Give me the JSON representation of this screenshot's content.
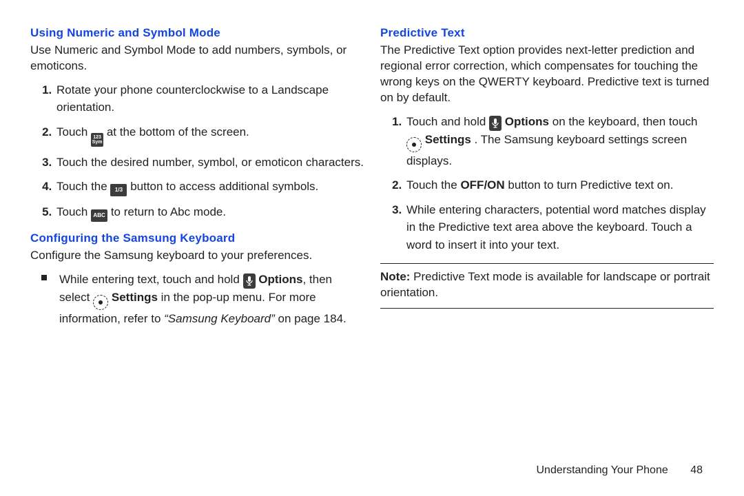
{
  "left": {
    "h_numeric": "Using Numeric and Symbol Mode",
    "numeric_intro": "Use Numeric and Symbol Mode to add numbers, symbols, or emoticons.",
    "steps_numsym": [
      {
        "a": "Rotate your phone counterclockwise to a Landscape orientation."
      },
      {
        "a": "Touch ",
        "icon": "123sym",
        "b": " at the bottom of the screen."
      },
      {
        "a": "Touch the desired number, symbol, or emoticon characters."
      },
      {
        "a": "Touch the ",
        "icon": "1of3",
        "b": " button to access additional symbols."
      },
      {
        "a": "Touch ",
        "icon": "abc",
        "b": " to return to Abc mode."
      }
    ],
    "h_config": "Configuring the Samsung Keyboard",
    "config_intro": "Configure the Samsung keyboard to your preferences.",
    "config_bullet": {
      "a": "While entering text, touch and hold ",
      "options": "Options",
      "b": ", then select ",
      "settings": "Settings",
      "c": " in the pop-up menu. ",
      "more": "For more information, refer to ",
      "ref": "“Samsung Keyboard”",
      "d": " on page 184."
    }
  },
  "right": {
    "h_pred": "Predictive Text",
    "pred_intro": "The Predictive Text option provides next-letter prediction and regional error correction, which compensates for touching the wrong keys on the QWERTY keyboard. Predictive text is turned on by default.",
    "step1": {
      "a": "Touch and hold ",
      "options": "Options",
      "b": " on the keyboard, then touch ",
      "settings": "Settings",
      "c": ". The Samsung keyboard settings screen displays."
    },
    "step2": {
      "a": "Touch the ",
      "bold": "OFF/ON",
      "b": " button to turn Predictive text on."
    },
    "step3": "While entering characters, potential word matches display in the Predictive text area above the keyboard. Touch a word to insert it into your text.",
    "note_label": "Note:",
    "note_body": " Predictive Text mode is available for landscape or portrait orientation."
  },
  "icons": {
    "key123top": "123",
    "key123bot": "Sym",
    "key1of3": "1/3",
    "keyabc": "ABC"
  },
  "footer": {
    "section": "Understanding Your Phone",
    "page": "48"
  }
}
